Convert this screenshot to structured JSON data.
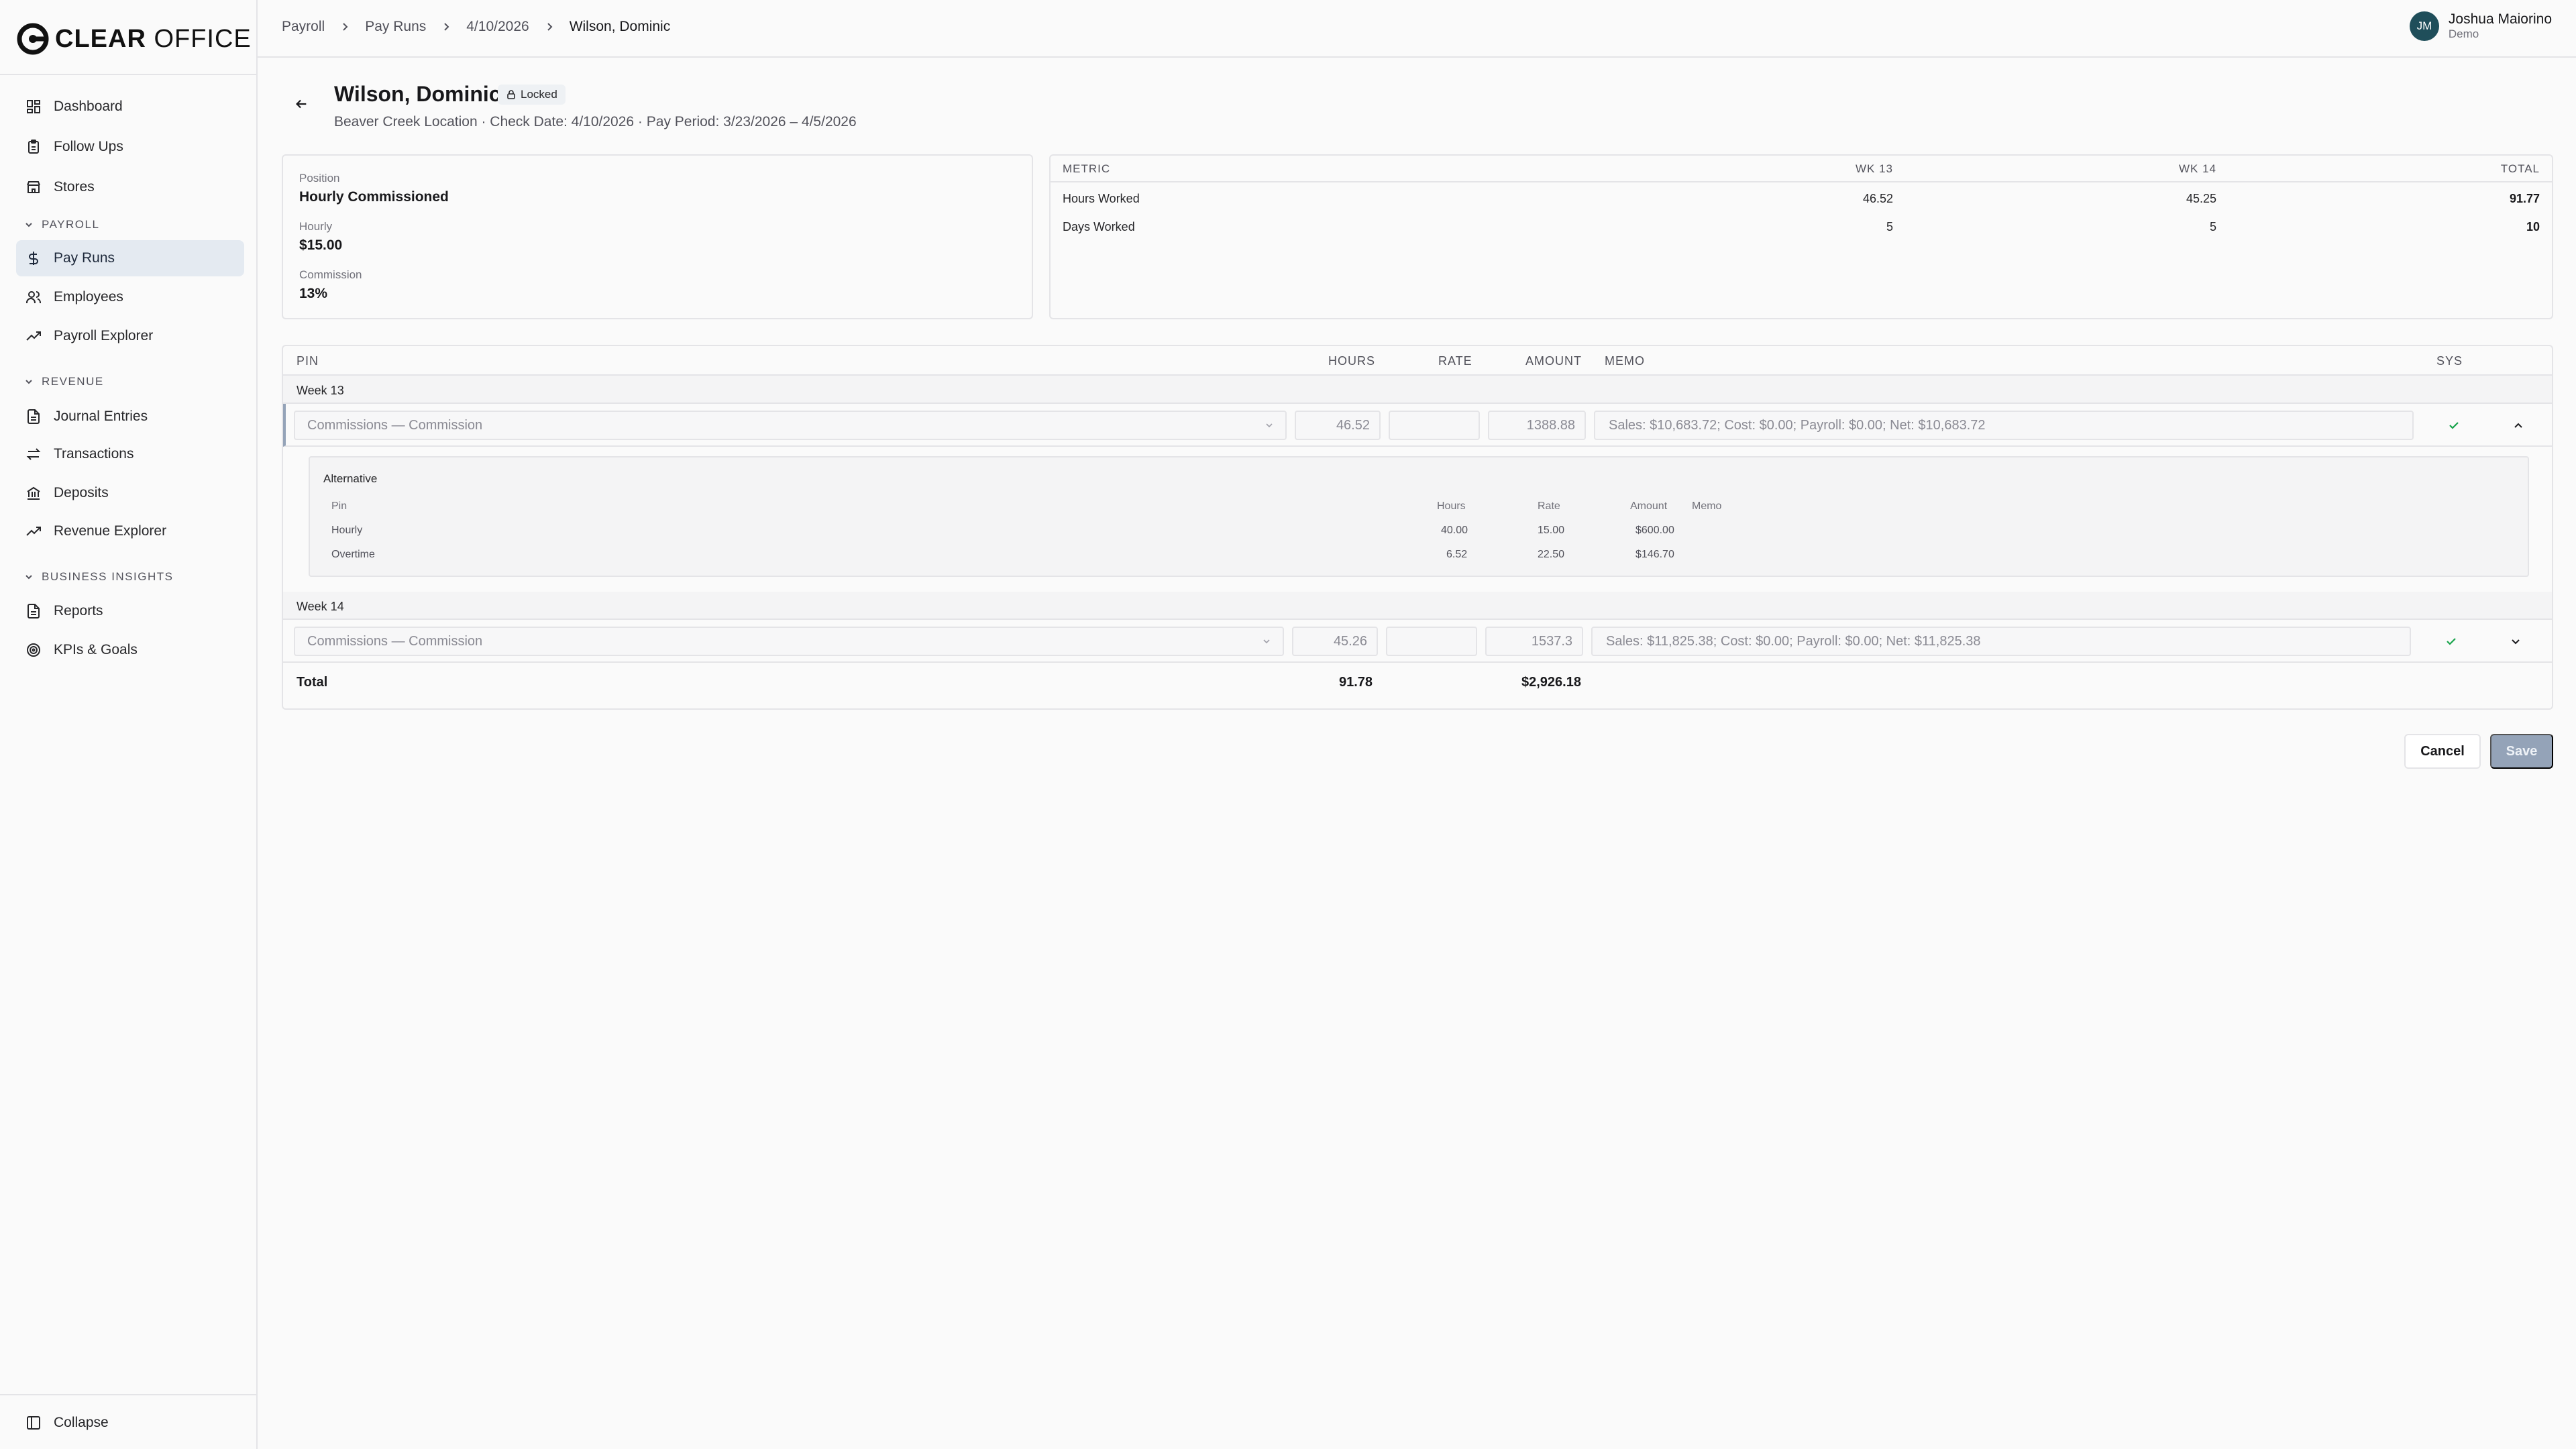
{
  "app": {
    "logo_text_bold": "CLEAR",
    "logo_text_light": " OFFICE"
  },
  "sidebar": {
    "items_top": [
      {
        "label": "Dashboard",
        "icon": "grid-icon"
      },
      {
        "label": "Follow Ups",
        "icon": "clipboard-icon"
      },
      {
        "label": "Stores",
        "icon": "store-icon"
      }
    ],
    "payroll_section": "PAYROLL",
    "payroll_items": [
      {
        "label": "Pay Runs",
        "icon": "dollar-icon",
        "active": true
      },
      {
        "label": "Employees",
        "icon": "users-icon"
      },
      {
        "label": "Payroll Explorer",
        "icon": "trending-icon"
      }
    ],
    "revenue_section": "REVENUE",
    "revenue_items": [
      {
        "label": "Journal Entries",
        "icon": "file-icon"
      },
      {
        "label": "Transactions",
        "icon": "swap-icon"
      },
      {
        "label": "Deposits",
        "icon": "bank-icon"
      },
      {
        "label": "Revenue Explorer",
        "icon": "trending-icon"
      }
    ],
    "insights_section": "BUSINESS INSIGHTS",
    "insights_items": [
      {
        "label": "Reports",
        "icon": "file-icon"
      },
      {
        "label": "KPIs & Goals",
        "icon": "target-icon"
      }
    ],
    "collapse_label": "Collapse"
  },
  "breadcrumb": [
    "Payroll",
    "Pay Runs",
    "4/10/2026",
    "Wilson, Dominic"
  ],
  "user": {
    "initials": "JM",
    "name": "Joshua Maiorino",
    "role": "Demo"
  },
  "employee": {
    "name": "Wilson, Dominic",
    "badge": "Locked",
    "subtitle": "Beaver Creek Location · Check Date: 4/10/2026 · Pay Period: 3/23/2026 – 4/5/2026",
    "position_label": "Position",
    "position": "Hourly Commissioned",
    "hourly_label": "Hourly",
    "hourly": "$15.00",
    "commission_label": "Commission",
    "commission": "13%"
  },
  "metrics": {
    "headers": [
      "METRIC",
      "WK 13",
      "WK 14",
      "TOTAL"
    ],
    "rows": [
      {
        "metric": "Hours Worked",
        "wk13": "46.52",
        "wk14": "45.25",
        "total": "91.77"
      },
      {
        "metric": "Days Worked",
        "wk13": "5",
        "wk14": "5",
        "total": "10"
      }
    ]
  },
  "lines": {
    "headers": {
      "pin": "PIN",
      "hours": "HOURS",
      "rate": "RATE",
      "amount": "AMOUNT",
      "memo": "MEMO",
      "sys": "SYS"
    },
    "week13": {
      "label": "Week 13",
      "pin": "Commissions — Commission",
      "hours": "46.52",
      "rate": "",
      "amount": "1388.88",
      "memo": "Sales: $10,683.72; Cost: $0.00; Payroll: $0.00; Net: $10,683.72"
    },
    "alternative": {
      "title": "Alternative",
      "headers": {
        "pin": "Pin",
        "hours": "Hours",
        "rate": "Rate",
        "amount": "Amount",
        "memo": "Memo"
      },
      "rows": [
        {
          "pin": "Hourly",
          "hours": "40.00",
          "rate": "15.00",
          "amount": "$600.00"
        },
        {
          "pin": "Overtime",
          "hours": "6.52",
          "rate": "22.50",
          "amount": "$146.70"
        }
      ]
    },
    "week14": {
      "label": "Week 14",
      "pin": "Commissions — Commission",
      "hours": "45.26",
      "rate": "",
      "amount": "1537.3",
      "memo": "Sales: $11,825.38; Cost: $0.00; Payroll: $0.00; Net: $11,825.38"
    },
    "total": {
      "label": "Total",
      "hours": "91.78",
      "amount": "$2,926.18"
    }
  },
  "actions": {
    "cancel": "Cancel",
    "save": "Save"
  },
  "colors": {
    "accent_check": "#16a34a",
    "save_disabled": "#94a3b8",
    "active_nav": "#e4eaf1"
  }
}
